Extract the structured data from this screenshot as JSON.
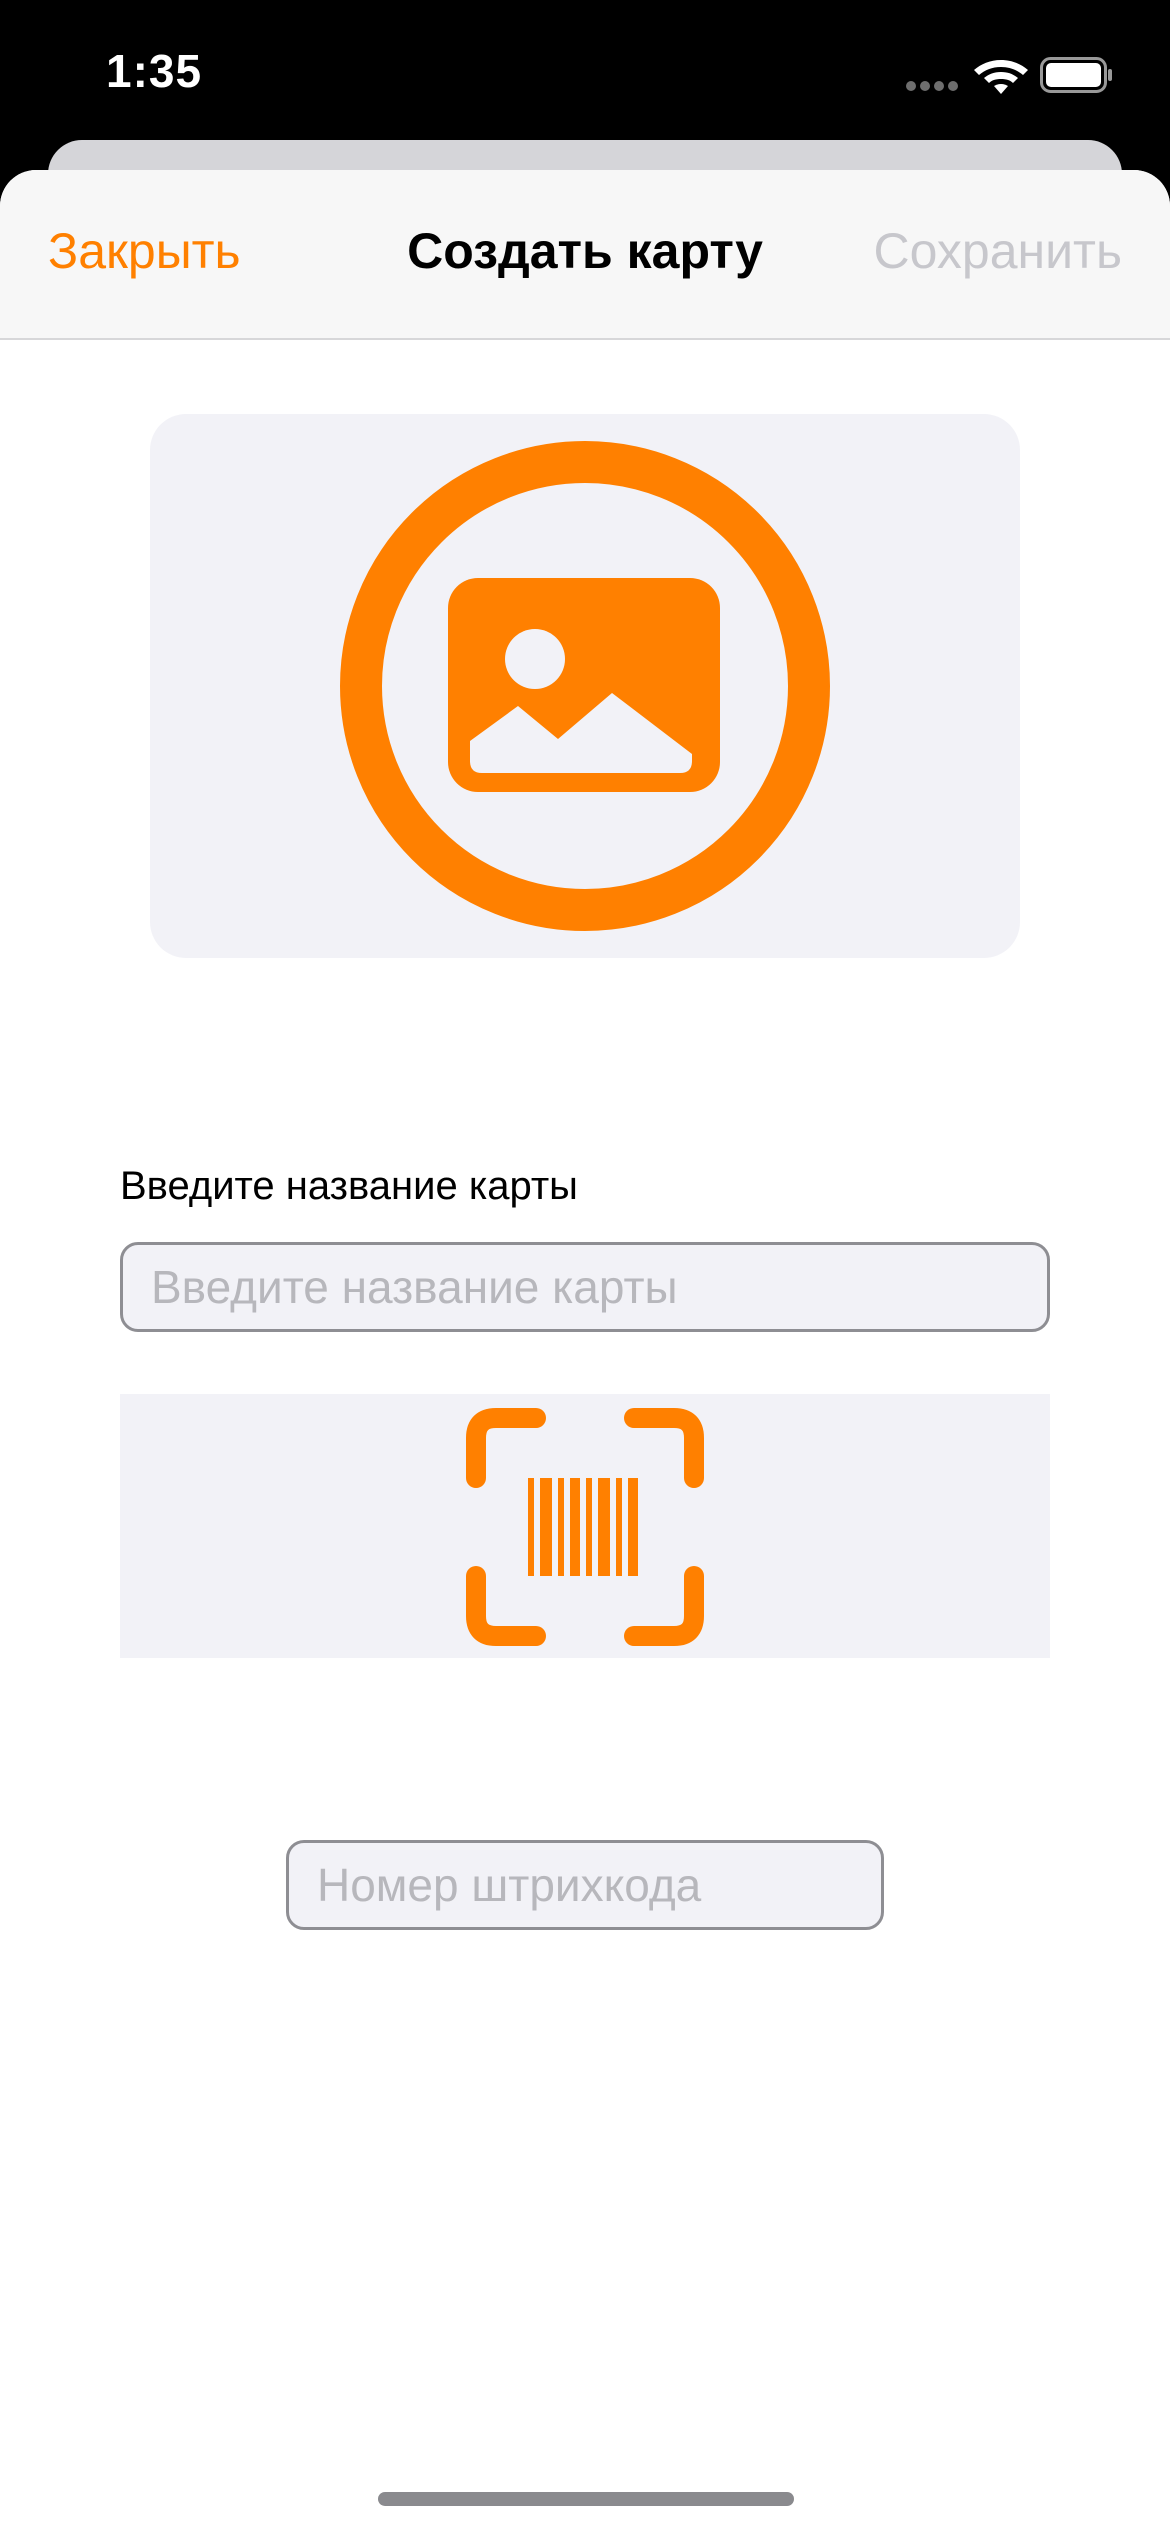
{
  "status_bar": {
    "time": "1:35",
    "icons": [
      "signal-dots-icon",
      "wifi-icon",
      "battery-icon"
    ]
  },
  "nav": {
    "close_label": "Закрыть",
    "title": "Создать карту",
    "save_label": "Сохранить"
  },
  "image_picker": {
    "icon": "photo-circle-icon"
  },
  "card_name": {
    "label": "Введите название карты",
    "placeholder": "Введите название карты",
    "value": ""
  },
  "barcode": {
    "scan_icon": "barcode-viewfinder-icon",
    "placeholder": "Номер штрихкода",
    "value": ""
  },
  "colors": {
    "accent": "#ff8000",
    "disabled": "#c7c7cc",
    "field_background": "#f2f2f7",
    "field_border": "#8e8e93"
  }
}
